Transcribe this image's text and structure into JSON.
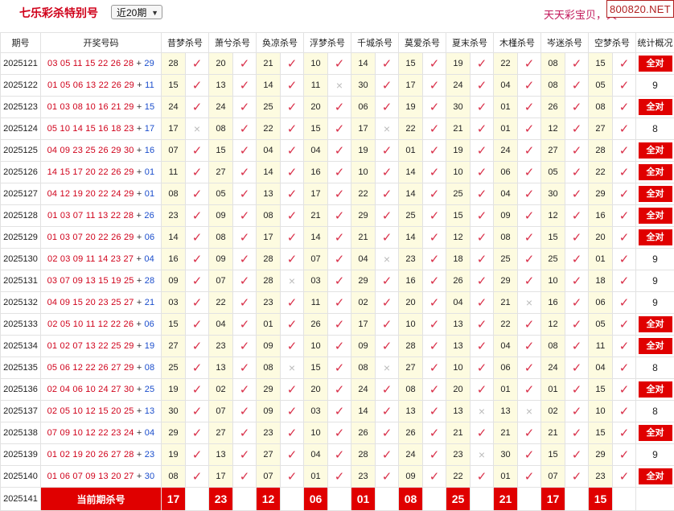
{
  "header": {
    "title": "七乐彩杀特别号",
    "period_selected": "近20期",
    "slogan": "天天彩宝贝，天",
    "watermark": "800820.NET"
  },
  "columns": [
    "期号",
    "开奖号码",
    "昔梦杀号",
    "萧兮杀号",
    "奂凉杀号",
    "浮梦杀号",
    "千城杀号",
    "莫爱杀号",
    "夏末杀号",
    "木槿杀号",
    "岑迷杀号",
    "空梦杀号",
    "统计概况"
  ],
  "rows": [
    {
      "issue": "2025121",
      "numbers": "03 05 11 15 22 26 28",
      "special": "29",
      "kills": [
        [
          "28",
          true
        ],
        [
          "20",
          true
        ],
        [
          "21",
          true
        ],
        [
          "10",
          true
        ],
        [
          "14",
          true
        ],
        [
          "15",
          true
        ],
        [
          "19",
          true
        ],
        [
          "22",
          true
        ],
        [
          "08",
          true
        ],
        [
          "15",
          true
        ]
      ],
      "stat": "全对"
    },
    {
      "issue": "2025122",
      "numbers": "01 05 06 13 22 26 29",
      "special": "11",
      "kills": [
        [
          "15",
          true
        ],
        [
          "13",
          true
        ],
        [
          "14",
          true
        ],
        [
          "11",
          false
        ],
        [
          "30",
          true
        ],
        [
          "17",
          true
        ],
        [
          "24",
          true
        ],
        [
          "04",
          true
        ],
        [
          "08",
          true
        ],
        [
          "05",
          true
        ]
      ],
      "stat": "9"
    },
    {
      "issue": "2025123",
      "numbers": "01 03 08 10 16 21 29",
      "special": "15",
      "kills": [
        [
          "24",
          true
        ],
        [
          "24",
          true
        ],
        [
          "25",
          true
        ],
        [
          "20",
          true
        ],
        [
          "06",
          true
        ],
        [
          "19",
          true
        ],
        [
          "30",
          true
        ],
        [
          "01",
          true
        ],
        [
          "26",
          true
        ],
        [
          "08",
          true
        ]
      ],
      "stat": "全对"
    },
    {
      "issue": "2025124",
      "numbers": "05 10 14 15 16 18 23",
      "special": "17",
      "kills": [
        [
          "17",
          false
        ],
        [
          "08",
          true
        ],
        [
          "22",
          true
        ],
        [
          "15",
          true
        ],
        [
          "17",
          false
        ],
        [
          "22",
          true
        ],
        [
          "21",
          true
        ],
        [
          "01",
          true
        ],
        [
          "12",
          true
        ],
        [
          "27",
          true
        ]
      ],
      "stat": "8"
    },
    {
      "issue": "2025125",
      "numbers": "04 09 23 25 26 29 30",
      "special": "16",
      "kills": [
        [
          "07",
          true
        ],
        [
          "15",
          true
        ],
        [
          "04",
          true
        ],
        [
          "04",
          true
        ],
        [
          "19",
          true
        ],
        [
          "01",
          true
        ],
        [
          "19",
          true
        ],
        [
          "24",
          true
        ],
        [
          "27",
          true
        ],
        [
          "28",
          true
        ]
      ],
      "stat": "全对"
    },
    {
      "issue": "2025126",
      "numbers": "14 15 17 20 22 26 29",
      "special": "01",
      "kills": [
        [
          "11",
          true
        ],
        [
          "27",
          true
        ],
        [
          "14",
          true
        ],
        [
          "16",
          true
        ],
        [
          "10",
          true
        ],
        [
          "14",
          true
        ],
        [
          "10",
          true
        ],
        [
          "06",
          true
        ],
        [
          "05",
          true
        ],
        [
          "22",
          true
        ]
      ],
      "stat": "全对"
    },
    {
      "issue": "2025127",
      "numbers": "04 12 19 20 22 24 29",
      "special": "01",
      "kills": [
        [
          "08",
          true
        ],
        [
          "05",
          true
        ],
        [
          "13",
          true
        ],
        [
          "17",
          true
        ],
        [
          "22",
          true
        ],
        [
          "14",
          true
        ],
        [
          "25",
          true
        ],
        [
          "04",
          true
        ],
        [
          "30",
          true
        ],
        [
          "29",
          true
        ]
      ],
      "stat": "全对"
    },
    {
      "issue": "2025128",
      "numbers": "01 03 07 11 13 22 28",
      "special": "26",
      "kills": [
        [
          "23",
          true
        ],
        [
          "09",
          true
        ],
        [
          "08",
          true
        ],
        [
          "21",
          true
        ],
        [
          "29",
          true
        ],
        [
          "25",
          true
        ],
        [
          "15",
          true
        ],
        [
          "09",
          true
        ],
        [
          "12",
          true
        ],
        [
          "16",
          true
        ]
      ],
      "stat": "全对"
    },
    {
      "issue": "2025129",
      "numbers": "01 03 07 20 22 26 29",
      "special": "06",
      "kills": [
        [
          "14",
          true
        ],
        [
          "08",
          true
        ],
        [
          "17",
          true
        ],
        [
          "14",
          true
        ],
        [
          "21",
          true
        ],
        [
          "14",
          true
        ],
        [
          "12",
          true
        ],
        [
          "08",
          true
        ],
        [
          "15",
          true
        ],
        [
          "20",
          true
        ]
      ],
      "stat": "全对"
    },
    {
      "issue": "2025130",
      "numbers": "02 03 09 11 14 23 27",
      "special": "04",
      "kills": [
        [
          "16",
          true
        ],
        [
          "09",
          true
        ],
        [
          "28",
          true
        ],
        [
          "07",
          true
        ],
        [
          "04",
          false
        ],
        [
          "23",
          true
        ],
        [
          "18",
          true
        ],
        [
          "25",
          true
        ],
        [
          "25",
          true
        ],
        [
          "01",
          true
        ]
      ],
      "stat": "9"
    },
    {
      "issue": "2025131",
      "numbers": "03 07 09 13 15 19 25",
      "special": "28",
      "kills": [
        [
          "09",
          true
        ],
        [
          "07",
          true
        ],
        [
          "28",
          false
        ],
        [
          "03",
          true
        ],
        [
          "29",
          true
        ],
        [
          "16",
          true
        ],
        [
          "26",
          true
        ],
        [
          "29",
          true
        ],
        [
          "10",
          true
        ],
        [
          "18",
          true
        ]
      ],
      "stat": "9"
    },
    {
      "issue": "2025132",
      "numbers": "04 09 15 20 23 25 27",
      "special": "21",
      "kills": [
        [
          "03",
          true
        ],
        [
          "22",
          true
        ],
        [
          "23",
          true
        ],
        [
          "11",
          true
        ],
        [
          "02",
          true
        ],
        [
          "20",
          true
        ],
        [
          "04",
          true
        ],
        [
          "21",
          false
        ],
        [
          "16",
          true
        ],
        [
          "06",
          true
        ]
      ],
      "stat": "9"
    },
    {
      "issue": "2025133",
      "numbers": "02 05 10 11 12 22 26",
      "special": "06",
      "kills": [
        [
          "15",
          true
        ],
        [
          "04",
          true
        ],
        [
          "01",
          true
        ],
        [
          "26",
          true
        ],
        [
          "17",
          true
        ],
        [
          "10",
          true
        ],
        [
          "13",
          true
        ],
        [
          "22",
          true
        ],
        [
          "12",
          true
        ],
        [
          "05",
          true
        ]
      ],
      "stat": "全对"
    },
    {
      "issue": "2025134",
      "numbers": "01 02 07 13 22 25 29",
      "special": "19",
      "kills": [
        [
          "27",
          true
        ],
        [
          "23",
          true
        ],
        [
          "09",
          true
        ],
        [
          "10",
          true
        ],
        [
          "09",
          true
        ],
        [
          "28",
          true
        ],
        [
          "13",
          true
        ],
        [
          "04",
          true
        ],
        [
          "08",
          true
        ],
        [
          "11",
          true
        ]
      ],
      "stat": "全对"
    },
    {
      "issue": "2025135",
      "numbers": "05 06 12 22 26 27 29",
      "special": "08",
      "kills": [
        [
          "25",
          true
        ],
        [
          "13",
          true
        ],
        [
          "08",
          false
        ],
        [
          "15",
          true
        ],
        [
          "08",
          false
        ],
        [
          "27",
          true
        ],
        [
          "10",
          true
        ],
        [
          "06",
          true
        ],
        [
          "24",
          true
        ],
        [
          "04",
          true
        ]
      ],
      "stat": "8"
    },
    {
      "issue": "2025136",
      "numbers": "02 04 06 10 24 27 30",
      "special": "25",
      "kills": [
        [
          "19",
          true
        ],
        [
          "02",
          true
        ],
        [
          "29",
          true
        ],
        [
          "20",
          true
        ],
        [
          "24",
          true
        ],
        [
          "08",
          true
        ],
        [
          "20",
          true
        ],
        [
          "01",
          true
        ],
        [
          "01",
          true
        ],
        [
          "15",
          true
        ]
      ],
      "stat": "全对"
    },
    {
      "issue": "2025137",
      "numbers": "02 05 10 12 15 20 25",
      "special": "13",
      "kills": [
        [
          "30",
          true
        ],
        [
          "07",
          true
        ],
        [
          "09",
          true
        ],
        [
          "03",
          true
        ],
        [
          "14",
          true
        ],
        [
          "13",
          true
        ],
        [
          "13",
          false
        ],
        [
          "13",
          false
        ],
        [
          "02",
          true
        ],
        [
          "10",
          true
        ]
      ],
      "stat": "8"
    },
    {
      "issue": "2025138",
      "numbers": "07 09 10 12 22 23 24",
      "special": "04",
      "kills": [
        [
          "29",
          true
        ],
        [
          "27",
          true
        ],
        [
          "23",
          true
        ],
        [
          "10",
          true
        ],
        [
          "26",
          true
        ],
        [
          "26",
          true
        ],
        [
          "21",
          true
        ],
        [
          "21",
          true
        ],
        [
          "21",
          true
        ],
        [
          "15",
          true
        ]
      ],
      "stat": "全对"
    },
    {
      "issue": "2025139",
      "numbers": "01 02 19 20 26 27 28",
      "special": "23",
      "kills": [
        [
          "19",
          true
        ],
        [
          "13",
          true
        ],
        [
          "27",
          true
        ],
        [
          "04",
          true
        ],
        [
          "28",
          true
        ],
        [
          "24",
          true
        ],
        [
          "23",
          false
        ],
        [
          "30",
          true
        ],
        [
          "15",
          true
        ],
        [
          "29",
          true
        ]
      ],
      "stat": "9"
    },
    {
      "issue": "2025140",
      "numbers": "01 06 07 09 13 20 27",
      "special": "30",
      "kills": [
        [
          "08",
          true
        ],
        [
          "17",
          true
        ],
        [
          "07",
          true
        ],
        [
          "01",
          true
        ],
        [
          "23",
          true
        ],
        [
          "09",
          true
        ],
        [
          "22",
          true
        ],
        [
          "01",
          true
        ],
        [
          "07",
          true
        ],
        [
          "23",
          true
        ]
      ],
      "stat": "全对"
    }
  ],
  "current": {
    "issue": "2025141",
    "label": "当前期杀号",
    "kills": [
      "17",
      "23",
      "12",
      "06",
      "01",
      "08",
      "25",
      "21",
      "17",
      "15"
    ]
  },
  "symbols": {
    "ok": "✓",
    "miss": "×",
    "plus": "+"
  },
  "colors": {
    "accent_red": "#e00000",
    "number_red": "#d0021b",
    "special_blue": "#1a4dcc",
    "highlight_yellow": "#fdfbe0"
  }
}
